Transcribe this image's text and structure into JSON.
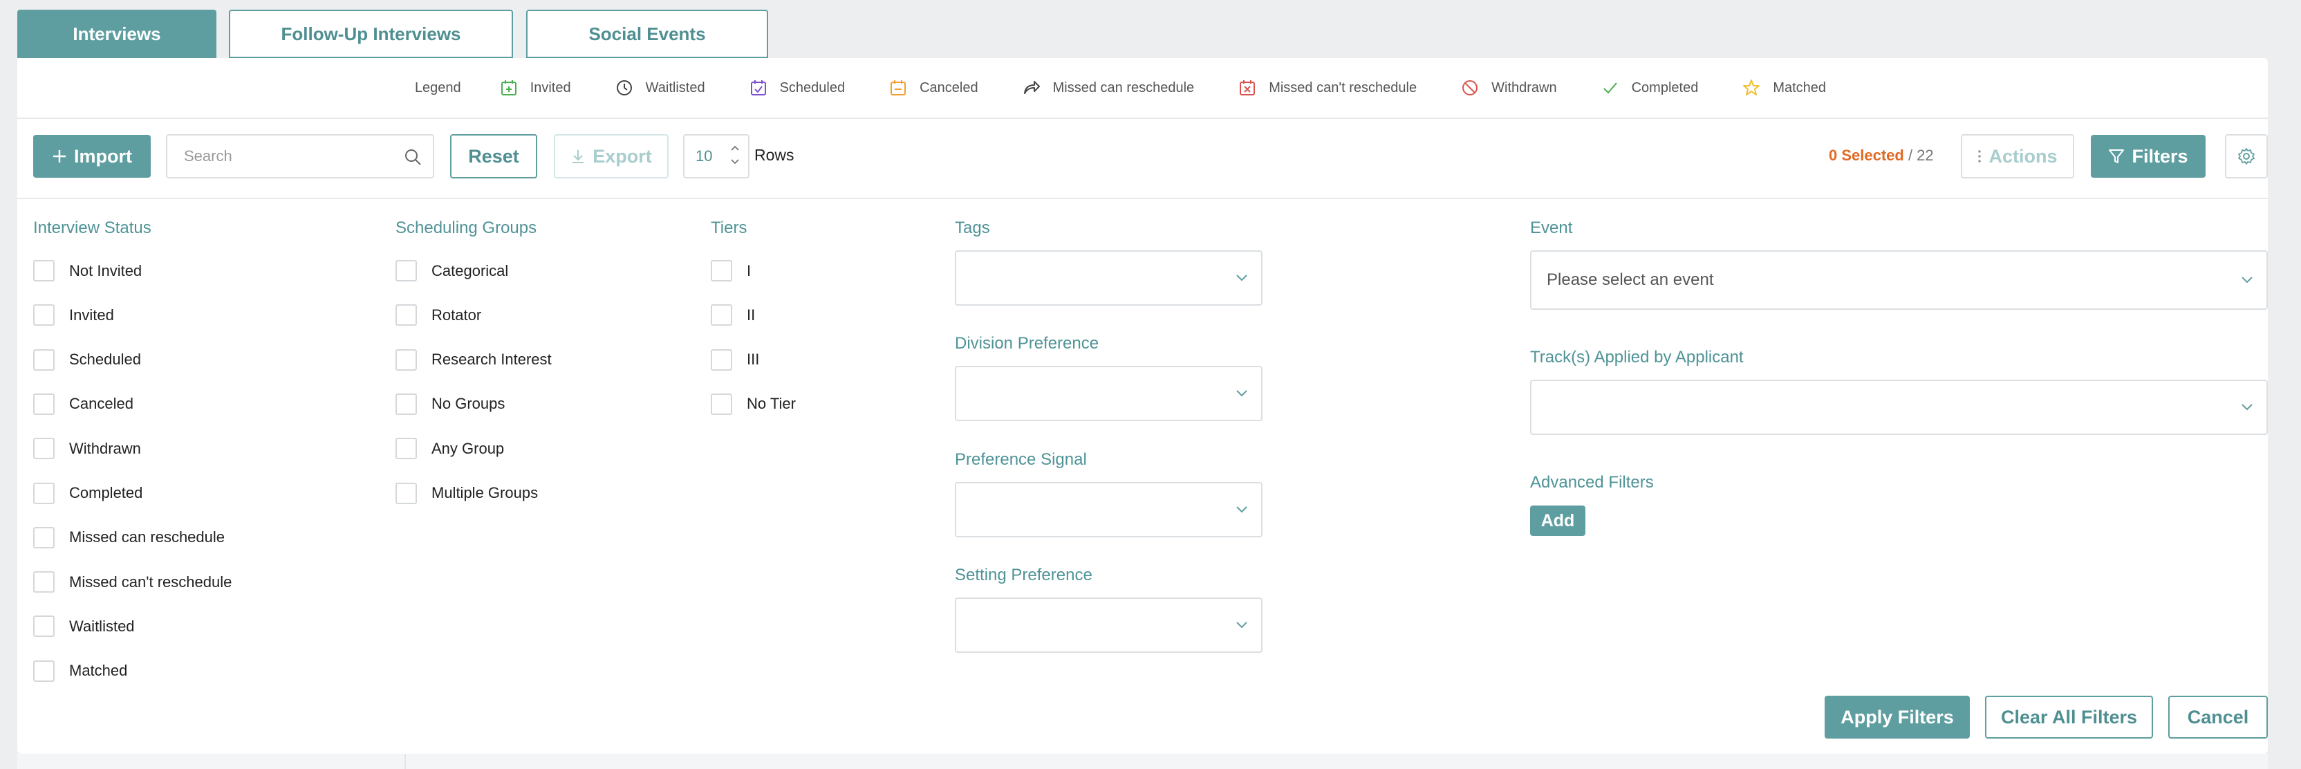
{
  "tabs": [
    {
      "label": "Interviews",
      "active": true
    },
    {
      "label": "Follow-Up Interviews",
      "active": false
    },
    {
      "label": "Social Events",
      "active": false
    }
  ],
  "legend": {
    "title": "Legend",
    "items": [
      {
        "label": "Invited",
        "icon": "calendar-plus-icon",
        "color": "#4caf50"
      },
      {
        "label": "Waitlisted",
        "icon": "clock-icon",
        "color": "#444444"
      },
      {
        "label": "Scheduled",
        "icon": "calendar-check-icon",
        "color": "#7b4fd0"
      },
      {
        "label": "Canceled",
        "icon": "calendar-minus-icon",
        "color": "#f0a030"
      },
      {
        "label": "Missed can reschedule",
        "icon": "share-arrow-icon",
        "color": "#444444"
      },
      {
        "label": "Missed can't reschedule",
        "icon": "calendar-x-icon",
        "color": "#d9534f"
      },
      {
        "label": "Withdrawn",
        "icon": "ban-icon",
        "color": "#d9534f"
      },
      {
        "label": "Completed",
        "icon": "checkmark-icon",
        "color": "#4caf50"
      },
      {
        "label": "Matched",
        "icon": "star-icon",
        "color": "#f0c030"
      }
    ]
  },
  "toolbar": {
    "import_label": "Import",
    "search_placeholder": "Search",
    "reset_label": "Reset",
    "export_label": "Export",
    "rows_value": "10",
    "rows_label": "Rows",
    "selected_count": "0 Selected",
    "selected_total": " / 22",
    "actions_label": "Actions",
    "filters_label": "Filters"
  },
  "filters": {
    "interview_status": {
      "title": "Interview Status",
      "options": [
        "Not Invited",
        "Invited",
        "Scheduled",
        "Canceled",
        "Withdrawn",
        "Completed",
        "Missed can reschedule",
        "Missed can't reschedule",
        "Waitlisted",
        "Matched"
      ]
    },
    "scheduling_groups": {
      "title": "Scheduling Groups",
      "options": [
        "Categorical",
        "Rotator",
        "Research Interest",
        "No Groups",
        "Any Group",
        "Multiple Groups"
      ]
    },
    "tiers": {
      "title": "Tiers",
      "options": [
        "I",
        "II",
        "III",
        "No Tier"
      ]
    },
    "tags": {
      "title": "Tags",
      "value": ""
    },
    "division_preference": {
      "title": "Division Preference",
      "value": ""
    },
    "preference_signal": {
      "title": "Preference Signal",
      "value": ""
    },
    "setting_preference": {
      "title": "Setting Preference",
      "value": ""
    },
    "event": {
      "title": "Event",
      "placeholder": "Please select an event"
    },
    "tracks": {
      "title": "Track(s) Applied by Applicant",
      "value": ""
    },
    "advanced": {
      "title": "Advanced Filters",
      "add_label": "Add"
    }
  },
  "footer": {
    "apply_label": "Apply Filters",
    "clear_label": "Clear All Filters",
    "cancel_label": "Cancel"
  },
  "colors": {
    "accent": "#5f9ea0",
    "selected": "#e06a24"
  }
}
